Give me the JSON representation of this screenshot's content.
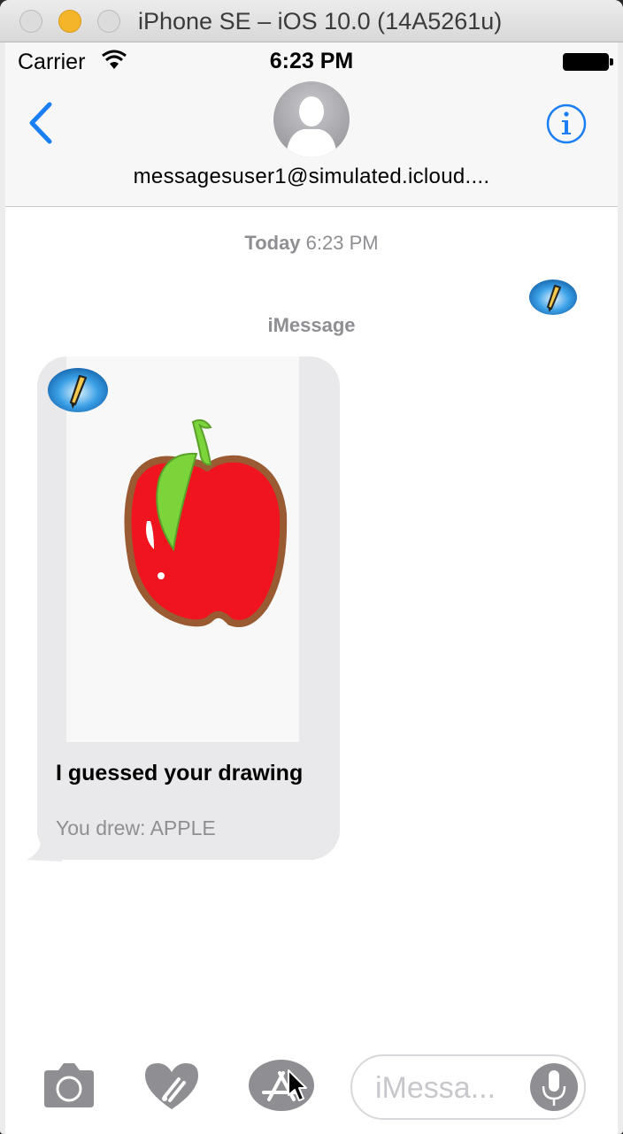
{
  "window": {
    "title": "iPhone SE – iOS 10.0 (14A5261u)"
  },
  "status_bar": {
    "carrier": "Carrier",
    "time": "6:23 PM"
  },
  "conversation": {
    "contact_name": "messagesuser1@simulated.icloud....",
    "timestamp_day": "Today",
    "timestamp_time": "6:23 PM",
    "service_label": "iMessage"
  },
  "message": {
    "title": "I guessed your drawing",
    "subtitle": "You drew: APPLE"
  },
  "input_bar": {
    "placeholder": "iMessa..."
  },
  "colors": {
    "ios_blue": "#1a7ef5",
    "bubble_gray": "#e9e9eb",
    "label_gray": "#8e8e93",
    "apple_red": "#f0141e",
    "apple_outline": "#9a5a32",
    "leaf_green": "#7ad43a"
  },
  "icons": {
    "back": "chevron-left-icon",
    "info": "info-icon",
    "camera": "camera-icon",
    "digital_touch": "heart-icon",
    "app_store": "app-store-icon",
    "microphone": "microphone-icon",
    "app_badge": "pencil-app-icon"
  }
}
